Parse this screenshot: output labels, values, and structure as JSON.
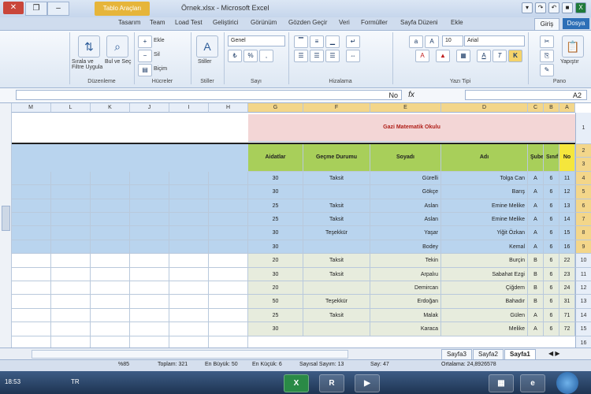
{
  "window": {
    "title": "Örnek.xlsx - Microsoft Excel",
    "context_tab": "Tablo Araçları"
  },
  "tabs": [
    "Tasarım",
    "Ekle",
    "Sayfa Düzeni",
    "Formüller",
    "Veri",
    "Gözden Geçir",
    "Görünüm",
    "Geliştirici",
    "Load Test",
    "Team"
  ],
  "tab_active": "Giriş",
  "tab_file": "Dosya",
  "ribbon": {
    "clipboard": {
      "label": "Pano",
      "paste": "Yapıştır"
    },
    "font": {
      "label": "Yazı Tipi",
      "font_name": "Arial",
      "font_size": "10"
    },
    "alignment": {
      "label": "Hizalama"
    },
    "number": {
      "label": "Sayı",
      "format": "Genel"
    },
    "styles": {
      "label": "Stiller",
      "btn": "Stiller"
    },
    "cells": {
      "label": "Hücreler",
      "insert": "Ekle",
      "delete": "Sil",
      "format": "Biçim"
    },
    "editing": {
      "label": "Düzenleme",
      "sort": "Sırala ve Filtre Uygula",
      "find": "Bul ve Seç"
    }
  },
  "formula_bar": {
    "name_box": "A2",
    "fx": "fx",
    "value": "No"
  },
  "columns": [
    "A",
    "B",
    "C",
    "D",
    "E",
    "F",
    "G",
    "H",
    "I",
    "J",
    "K",
    "L",
    "M"
  ],
  "rows": [
    "2",
    "3",
    "4",
    "5",
    "6",
    "7",
    "8",
    "9",
    "10",
    "11",
    "12",
    "13",
    "14",
    "15",
    "16"
  ],
  "sheet": {
    "title": "Gazi Matematik Okulu",
    "headers": [
      "No",
      "Sınıf",
      "Şube",
      "Adı",
      "Soyadı",
      "Geçme Durumu",
      "Aidatlar"
    ],
    "rows": [
      [
        "11",
        "6",
        "A",
        "Tolga Can",
        "Gürelli",
        "Taksit",
        "30"
      ],
      [
        "12",
        "6",
        "A",
        "Barış",
        "Gökçe",
        "",
        "30"
      ],
      [
        "13",
        "6",
        "A",
        "Emine Melike",
        "Aslan",
        "Taksit",
        "25"
      ],
      [
        "14",
        "6",
        "A",
        "Emine Melike",
        "Aslan",
        "Taksit",
        "25"
      ],
      [
        "15",
        "6",
        "A",
        "Yiğit Özkan",
        "Yaşar",
        "Teşekkür",
        "30"
      ],
      [
        "16",
        "6",
        "A",
        "Kemal",
        "Bodey",
        "",
        "30"
      ],
      [
        "22",
        "6",
        "B",
        "Burçin",
        "Tekin",
        "Taksit",
        "20"
      ],
      [
        "23",
        "6",
        "B",
        "Sabahat Ezgi",
        "Arpalıu",
        "Taksit",
        "30"
      ],
      [
        "24",
        "6",
        "B",
        "Çiğdem",
        "Demircan",
        "",
        "20"
      ],
      [
        "31",
        "6",
        "B",
        "Bahadır",
        "Erdoğan",
        "Teşekkür",
        "50"
      ],
      [
        "71",
        "6",
        "A",
        "Gülen",
        "Malak",
        "Taksit",
        "25"
      ],
      [
        "72",
        "6",
        "A",
        "Melike",
        "Karaca",
        "",
        "30"
      ]
    ]
  },
  "sheet_tabs": [
    "Sayfa1",
    "Sayfa2",
    "Sayfa3"
  ],
  "sheet_tab_active": "Sayfa1",
  "status": {
    "average": "Ortalama: 24,8926578",
    "count": "Say: 47",
    "num_count": "Sayısal Sayım: 13",
    "min": "En Küçük: 6",
    "max": "En Büyük: 50",
    "sum": "Toplam: 321",
    "zoom": "%85"
  },
  "taskbar": {
    "clock": "18:53",
    "lang": "TR"
  },
  "colors": {
    "header_green": "#a8cf5a",
    "no_yellow": "#f5e63c",
    "selection": "#b9d4ee",
    "title_band": "#f3d6d6"
  }
}
